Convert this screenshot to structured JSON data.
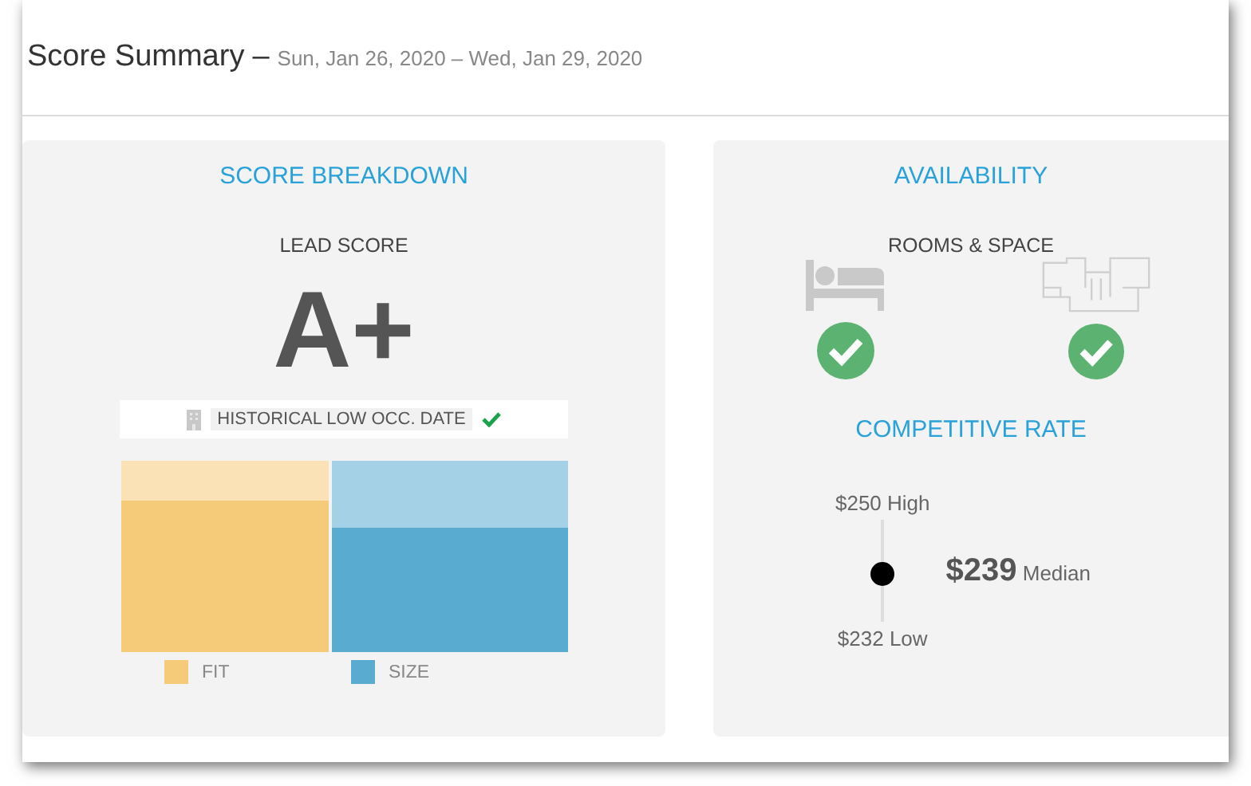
{
  "header": {
    "title": "Score Summary",
    "separator": "–",
    "date_range": "Sun, Jan 26, 2020 – Wed, Jan 29, 2020"
  },
  "score_breakdown": {
    "title": "SCORE BREAKDOWN",
    "label": "LEAD SCORE",
    "grade": "A+",
    "factor": {
      "label": "HISTORICAL LOW OCC. DATE",
      "checked": true
    },
    "legend": [
      {
        "label": "FIT",
        "color": "#f5cb7a"
      },
      {
        "label": "SIZE",
        "color": "#59abd0"
      }
    ]
  },
  "availability": {
    "title": "AVAILABILITY",
    "label": "ROOMS & SPACE",
    "items": [
      {
        "kind": "rooms",
        "available": true
      },
      {
        "kind": "space",
        "available": true
      }
    ],
    "rate_title": "COMPETITIVE RATE",
    "high": {
      "value": "$250",
      "label": "High"
    },
    "median": {
      "value": "$239",
      "label": "Median"
    },
    "low": {
      "value": "$232",
      "label": "Low"
    }
  }
}
